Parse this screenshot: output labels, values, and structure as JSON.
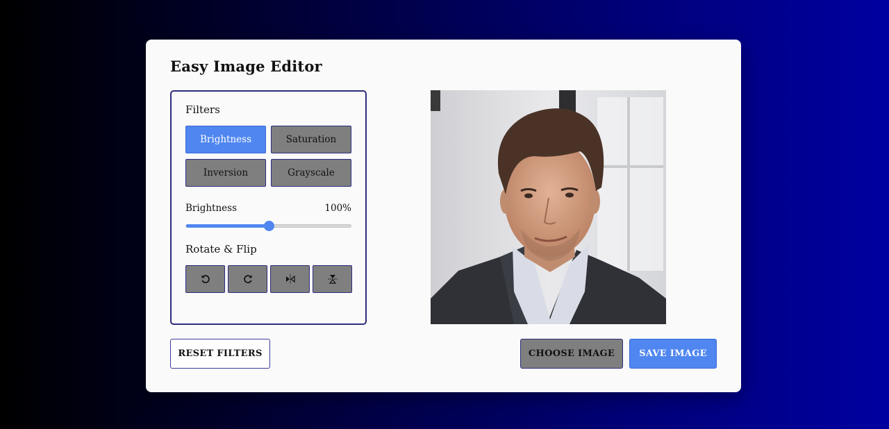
{
  "app": {
    "title": "Easy Image Editor"
  },
  "filters": {
    "heading": "Filters",
    "buttons": [
      {
        "label": "Brightness",
        "active": true
      },
      {
        "label": "Saturation",
        "active": false
      },
      {
        "label": "Inversion",
        "active": false
      },
      {
        "label": "Grayscale",
        "active": false
      }
    ],
    "slider": {
      "name": "Brightness",
      "value_text": "100%",
      "value": 100,
      "max": 200
    }
  },
  "rotate_flip": {
    "heading": "Rotate & Flip",
    "buttons": [
      {
        "icon": "rotate-left-icon"
      },
      {
        "icon": "rotate-right-icon"
      },
      {
        "icon": "flip-horizontal-icon"
      },
      {
        "icon": "flip-vertical-icon"
      }
    ]
  },
  "preview": {
    "subject": "portrait photo of a smiling man in a dark suit jacket"
  },
  "actions": {
    "reset_label": "RESET FILTERS",
    "choose_label": "CHOOSE IMAGE",
    "save_label": "SAVE IMAGE"
  },
  "colors": {
    "accent": "#4f86f0",
    "button_gray": "#7f7f7f",
    "border_navy": "#2c2c7a",
    "card_bg": "#fafafa"
  }
}
